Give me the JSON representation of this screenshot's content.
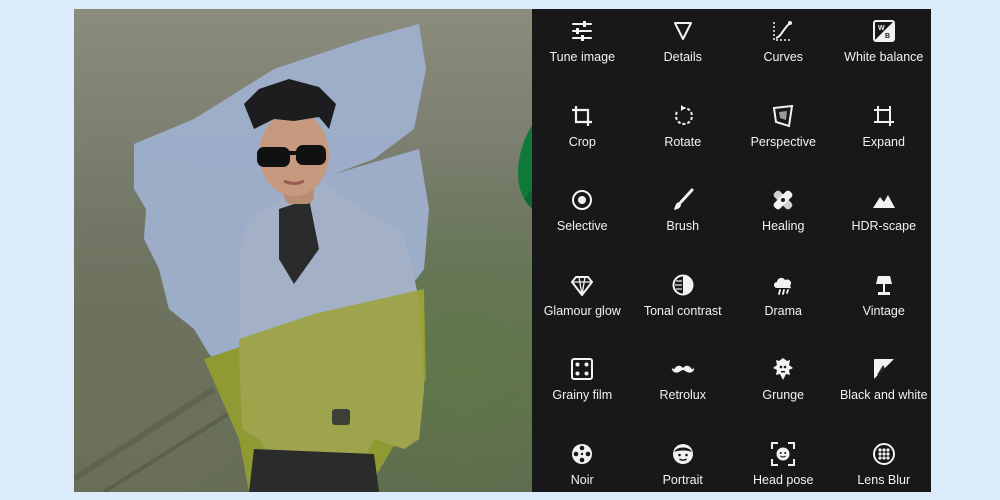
{
  "colors": {
    "page_background": "#dcebfb",
    "panel_background": "#181818",
    "tool_text": "#f2f2f2",
    "logo_green_dark": "#0f7a3a",
    "logo_green_mid": "#2fa046",
    "logo_green_light": "#8fd14f",
    "logo_card": "#e6e6e6"
  },
  "tools": [
    {
      "label": "Tune image",
      "icon": "sliders-icon"
    },
    {
      "label": "Details",
      "icon": "triangle-down-icon"
    },
    {
      "label": "Curves",
      "icon": "curves-icon"
    },
    {
      "label": "White balance",
      "icon": "white-balance-icon"
    },
    {
      "label": "Crop",
      "icon": "crop-icon"
    },
    {
      "label": "Rotate",
      "icon": "rotate-icon"
    },
    {
      "label": "Perspective",
      "icon": "perspective-icon"
    },
    {
      "label": "Expand",
      "icon": "expand-icon"
    },
    {
      "label": "Selective",
      "icon": "selective-target-icon"
    },
    {
      "label": "Brush",
      "icon": "brush-icon"
    },
    {
      "label": "Healing",
      "icon": "bandage-icon"
    },
    {
      "label": "HDR-scape",
      "icon": "mountains-icon"
    },
    {
      "label": "Glamour glow",
      "icon": "diamond-icon"
    },
    {
      "label": "Tonal contrast",
      "icon": "half-circle-icon"
    },
    {
      "label": "Drama",
      "icon": "storm-cloud-icon"
    },
    {
      "label": "Vintage",
      "icon": "lamp-icon"
    },
    {
      "label": "Grainy film",
      "icon": "dice-icon"
    },
    {
      "label": "Retrolux",
      "icon": "mustache-icon"
    },
    {
      "label": "Grunge",
      "icon": "grunge-icon"
    },
    {
      "label": "Black and white",
      "icon": "black-white-icon"
    },
    {
      "label": "Noir",
      "icon": "film-reel-icon"
    },
    {
      "label": "Portrait",
      "icon": "face-icon"
    },
    {
      "label": "Head pose",
      "icon": "face-frame-icon"
    },
    {
      "label": "Lens Blur",
      "icon": "lens-blur-icon"
    }
  ]
}
